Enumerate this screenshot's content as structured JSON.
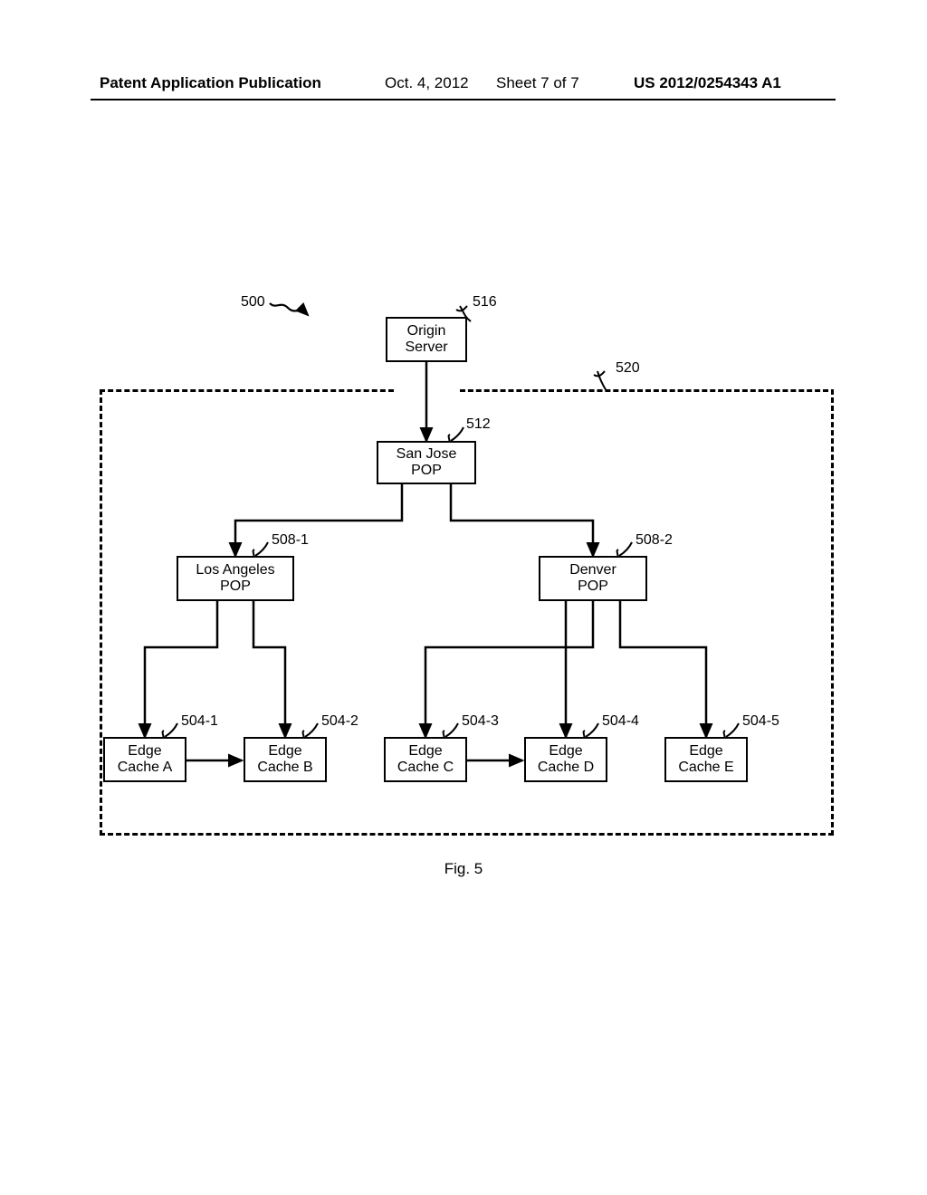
{
  "header": {
    "left": "Patent Application Publication",
    "date": "Oct. 4, 2012",
    "sheet": "Sheet 7 of 7",
    "pubno": "US 2012/0254343 A1"
  },
  "figure": {
    "caption": "Fig. 5",
    "refs": {
      "r500": "500",
      "r516": "516",
      "r520": "520",
      "r512": "512",
      "r508_1": "508-1",
      "r508_2": "508-2",
      "r504_1": "504-1",
      "r504_2": "504-2",
      "r504_3": "504-3",
      "r504_4": "504-4",
      "r504_5": "504-5"
    },
    "boxes": {
      "origin": "Origin\nServer",
      "sanjose": "San Jose\nPOP",
      "la": "Los Angeles\nPOP",
      "denver": "Denver\nPOP",
      "edgeA": "Edge\nCache A",
      "edgeB": "Edge\nCache B",
      "edgeC": "Edge\nCache C",
      "edgeD": "Edge\nCache D",
      "edgeE": "Edge\nCache E"
    }
  }
}
